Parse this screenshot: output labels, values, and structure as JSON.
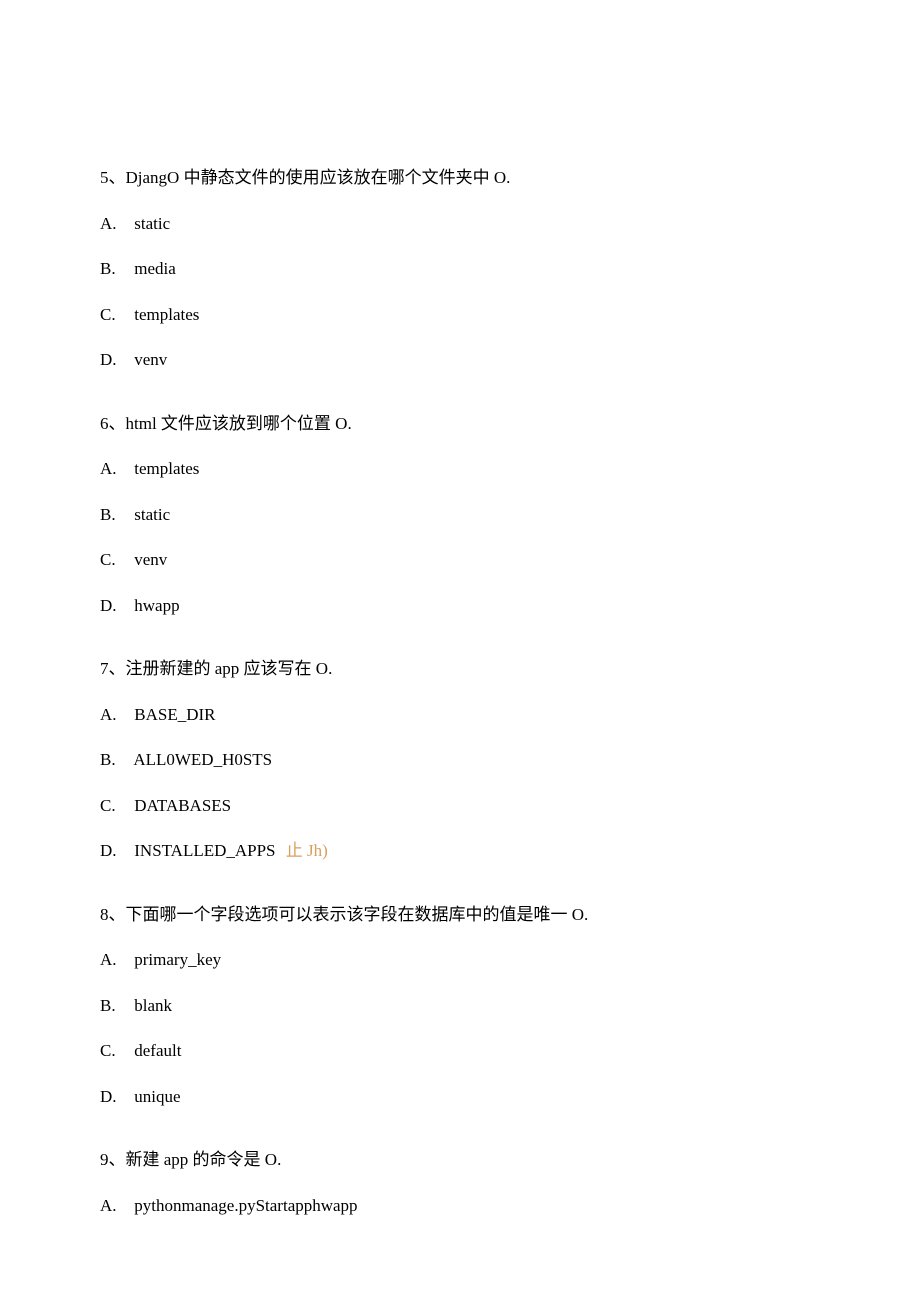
{
  "questions": [
    {
      "number": "5",
      "stem": "DjangO 中静态文件的使用应该放在哪个文件夹中 O.",
      "options": [
        {
          "label": "A.",
          "text": "static"
        },
        {
          "label": "B.",
          "text": "media"
        },
        {
          "label": "C.",
          "text": "templates"
        },
        {
          "label": "D.",
          "text": "venv"
        }
      ]
    },
    {
      "number": "6",
      "stem": "html 文件应该放到哪个位置 O.",
      "options": [
        {
          "label": "A.",
          "text": "templates"
        },
        {
          "label": "B.",
          "text": "static"
        },
        {
          "label": "C.",
          "text": "venv"
        },
        {
          "label": "D.",
          "text": "hwapp"
        }
      ]
    },
    {
      "number": "7",
      "stem": "注册新建的 app 应该写在 O.",
      "options": [
        {
          "label": "A.",
          "text": "BASE_DIR"
        },
        {
          "label": "B.",
          "text": "ALL0WED_H0STS"
        },
        {
          "label": "C.",
          "text": "DATABASES"
        },
        {
          "label": "D.",
          "text": "INSTALLED_APPS",
          "annotation": "⽌ Jh)"
        }
      ]
    },
    {
      "number": "8",
      "stem": "下面哪一个字段选项可以表示该字段在数据库中的值是唯一 O.",
      "options": [
        {
          "label": "A.",
          "text": "primary_key"
        },
        {
          "label": "B.",
          "text": "blank"
        },
        {
          "label": "C.",
          "text": "default"
        },
        {
          "label": "D.",
          "text": "unique"
        }
      ]
    },
    {
      "number": "9",
      "stem": "新建 app 的命令是 O.",
      "options": [
        {
          "label": "A.",
          "text": "pythonmanage.pyStartapphwapp"
        }
      ]
    }
  ],
  "separator": "、"
}
